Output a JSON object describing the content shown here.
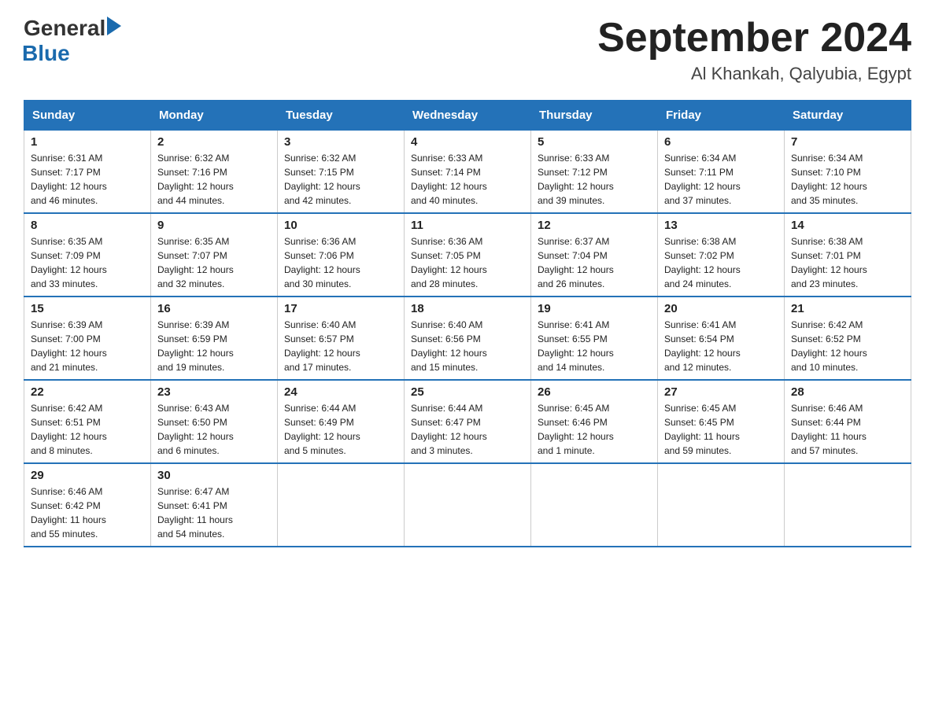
{
  "header": {
    "logo_general": "General",
    "logo_blue": "Blue",
    "title": "September 2024",
    "subtitle": "Al Khankah, Qalyubia, Egypt"
  },
  "days_of_week": [
    "Sunday",
    "Monday",
    "Tuesday",
    "Wednesday",
    "Thursday",
    "Friday",
    "Saturday"
  ],
  "weeks": [
    [
      {
        "num": "1",
        "info": "Sunrise: 6:31 AM\nSunset: 7:17 PM\nDaylight: 12 hours\nand 46 minutes."
      },
      {
        "num": "2",
        "info": "Sunrise: 6:32 AM\nSunset: 7:16 PM\nDaylight: 12 hours\nand 44 minutes."
      },
      {
        "num": "3",
        "info": "Sunrise: 6:32 AM\nSunset: 7:15 PM\nDaylight: 12 hours\nand 42 minutes."
      },
      {
        "num": "4",
        "info": "Sunrise: 6:33 AM\nSunset: 7:14 PM\nDaylight: 12 hours\nand 40 minutes."
      },
      {
        "num": "5",
        "info": "Sunrise: 6:33 AM\nSunset: 7:12 PM\nDaylight: 12 hours\nand 39 minutes."
      },
      {
        "num": "6",
        "info": "Sunrise: 6:34 AM\nSunset: 7:11 PM\nDaylight: 12 hours\nand 37 minutes."
      },
      {
        "num": "7",
        "info": "Sunrise: 6:34 AM\nSunset: 7:10 PM\nDaylight: 12 hours\nand 35 minutes."
      }
    ],
    [
      {
        "num": "8",
        "info": "Sunrise: 6:35 AM\nSunset: 7:09 PM\nDaylight: 12 hours\nand 33 minutes."
      },
      {
        "num": "9",
        "info": "Sunrise: 6:35 AM\nSunset: 7:07 PM\nDaylight: 12 hours\nand 32 minutes."
      },
      {
        "num": "10",
        "info": "Sunrise: 6:36 AM\nSunset: 7:06 PM\nDaylight: 12 hours\nand 30 minutes."
      },
      {
        "num": "11",
        "info": "Sunrise: 6:36 AM\nSunset: 7:05 PM\nDaylight: 12 hours\nand 28 minutes."
      },
      {
        "num": "12",
        "info": "Sunrise: 6:37 AM\nSunset: 7:04 PM\nDaylight: 12 hours\nand 26 minutes."
      },
      {
        "num": "13",
        "info": "Sunrise: 6:38 AM\nSunset: 7:02 PM\nDaylight: 12 hours\nand 24 minutes."
      },
      {
        "num": "14",
        "info": "Sunrise: 6:38 AM\nSunset: 7:01 PM\nDaylight: 12 hours\nand 23 minutes."
      }
    ],
    [
      {
        "num": "15",
        "info": "Sunrise: 6:39 AM\nSunset: 7:00 PM\nDaylight: 12 hours\nand 21 minutes."
      },
      {
        "num": "16",
        "info": "Sunrise: 6:39 AM\nSunset: 6:59 PM\nDaylight: 12 hours\nand 19 minutes."
      },
      {
        "num": "17",
        "info": "Sunrise: 6:40 AM\nSunset: 6:57 PM\nDaylight: 12 hours\nand 17 minutes."
      },
      {
        "num": "18",
        "info": "Sunrise: 6:40 AM\nSunset: 6:56 PM\nDaylight: 12 hours\nand 15 minutes."
      },
      {
        "num": "19",
        "info": "Sunrise: 6:41 AM\nSunset: 6:55 PM\nDaylight: 12 hours\nand 14 minutes."
      },
      {
        "num": "20",
        "info": "Sunrise: 6:41 AM\nSunset: 6:54 PM\nDaylight: 12 hours\nand 12 minutes."
      },
      {
        "num": "21",
        "info": "Sunrise: 6:42 AM\nSunset: 6:52 PM\nDaylight: 12 hours\nand 10 minutes."
      }
    ],
    [
      {
        "num": "22",
        "info": "Sunrise: 6:42 AM\nSunset: 6:51 PM\nDaylight: 12 hours\nand 8 minutes."
      },
      {
        "num": "23",
        "info": "Sunrise: 6:43 AM\nSunset: 6:50 PM\nDaylight: 12 hours\nand 6 minutes."
      },
      {
        "num": "24",
        "info": "Sunrise: 6:44 AM\nSunset: 6:49 PM\nDaylight: 12 hours\nand 5 minutes."
      },
      {
        "num": "25",
        "info": "Sunrise: 6:44 AM\nSunset: 6:47 PM\nDaylight: 12 hours\nand 3 minutes."
      },
      {
        "num": "26",
        "info": "Sunrise: 6:45 AM\nSunset: 6:46 PM\nDaylight: 12 hours\nand 1 minute."
      },
      {
        "num": "27",
        "info": "Sunrise: 6:45 AM\nSunset: 6:45 PM\nDaylight: 11 hours\nand 59 minutes."
      },
      {
        "num": "28",
        "info": "Sunrise: 6:46 AM\nSunset: 6:44 PM\nDaylight: 11 hours\nand 57 minutes."
      }
    ],
    [
      {
        "num": "29",
        "info": "Sunrise: 6:46 AM\nSunset: 6:42 PM\nDaylight: 11 hours\nand 55 minutes."
      },
      {
        "num": "30",
        "info": "Sunrise: 6:47 AM\nSunset: 6:41 PM\nDaylight: 11 hours\nand 54 minutes."
      },
      null,
      null,
      null,
      null,
      null
    ]
  ]
}
